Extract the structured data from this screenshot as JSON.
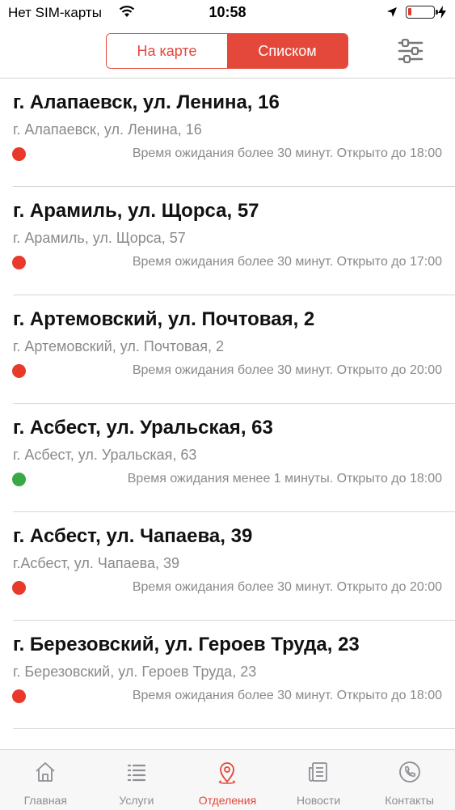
{
  "status_bar": {
    "carrier": "Нет SIM-карты",
    "time": "10:58",
    "icons": [
      "wifi-icon",
      "location-arrow-icon",
      "battery-icon",
      "charging-icon"
    ]
  },
  "header": {
    "segments": {
      "map_label": "На карте",
      "list_label": "Списком",
      "selected": "Списком"
    },
    "filter_icon": "sliders-icon"
  },
  "colors": {
    "accent": "#e3483a",
    "status_red": "#e8392b",
    "status_green": "#3aa845",
    "secondary_text": "#8a8a8a"
  },
  "branches": [
    {
      "title": "г. Алапаевск, ул. Ленина, 16",
      "address": "г. Алапаевск, ул. Ленина, 16",
      "status_color": "red",
      "status": "Время ожидания более 30 минут. Открыто до 18:00"
    },
    {
      "title": "г. Арамиль, ул. Щорса, 57",
      "address": "г. Арамиль, ул. Щорса, 57",
      "status_color": "red",
      "status": "Время ожидания более 30 минут. Открыто до 17:00"
    },
    {
      "title": "г. Артемовский, ул. Почтовая, 2",
      "address": "г. Артемовский, ул. Почтовая, 2",
      "status_color": "red",
      "status": "Время ожидания более 30 минут. Открыто до 20:00"
    },
    {
      "title": "г. Асбест, ул. Уральская, 63",
      "address": "г. Асбест, ул. Уральская,  63",
      "status_color": "green",
      "status": "Время ожидания менее 1 минуты. Открыто до 18:00"
    },
    {
      "title": "г. Асбест, ул. Чапаева, 39",
      "address": "г.Асбест, ул. Чапаева,  39",
      "status_color": "red",
      "status": "Время ожидания более 30 минут. Открыто до 20:00"
    },
    {
      "title": "г. Березовский, ул. Героев Труда, 23",
      "address": "г. Березовский, ул. Героев Труда, 23",
      "status_color": "red",
      "status": "Время ожидания более 30 минут. Открыто до 18:00"
    }
  ],
  "tab_bar": {
    "active": "Отделения",
    "tabs": [
      {
        "label": "Главная",
        "icon": "home-icon"
      },
      {
        "label": "Услуги",
        "icon": "list-icon"
      },
      {
        "label": "Отделения",
        "icon": "map-pin-icon"
      },
      {
        "label": "Новости",
        "icon": "news-icon"
      },
      {
        "label": "Контакты",
        "icon": "phone-icon"
      }
    ]
  }
}
